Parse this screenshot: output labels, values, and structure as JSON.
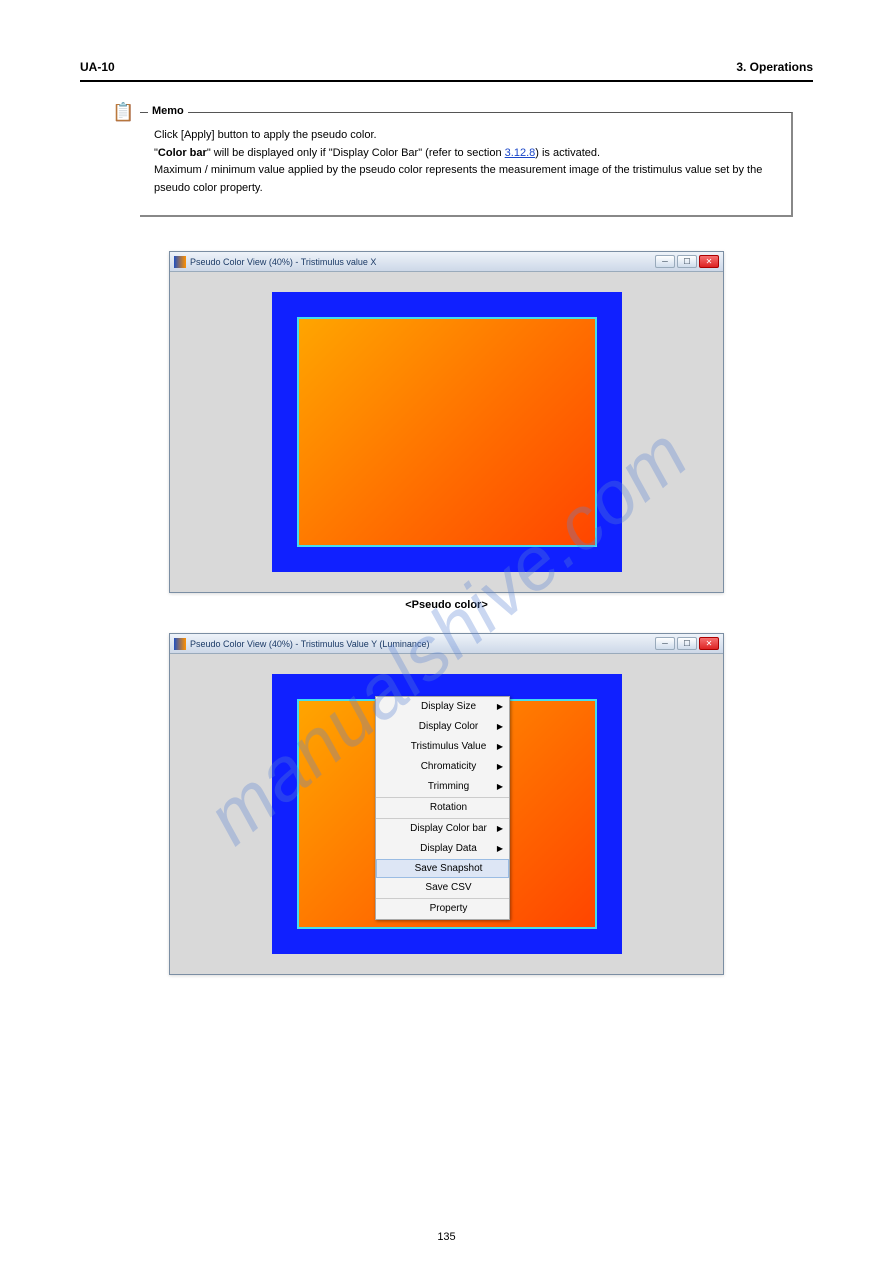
{
  "header": {
    "left": "UA-10",
    "right": "3. Operations"
  },
  "memo": {
    "label": "Memo",
    "line1": "Click [Apply] button to apply the pseudo color.",
    "line2_prefix": "\"",
    "line2_bold": "Color bar",
    "line2_mid": "\" will be displayed only if \"Display Color Bar\" (refer to section",
    "line2_ref": "3.12.8",
    "line2_end": ") is activated.",
    "line3": "Maximum / minimum value applied by the pseudo color represents the measurement image of the tristimulus value set by the pseudo color property."
  },
  "window1": {
    "title": "Pseudo Color View (40%) - Tristimulus value X",
    "caption": "<Pseudo color>"
  },
  "window2": {
    "title": "Pseudo Color View (40%) - Tristimulus Value Y (Luminance)",
    "menu": {
      "items": [
        {
          "label": "Display Size",
          "arrow": true
        },
        {
          "label": "Display Color",
          "arrow": true
        },
        {
          "label": "Tristimulus Value",
          "arrow": true
        },
        {
          "label": "Chromaticity",
          "arrow": true
        },
        {
          "label": "Trimming",
          "arrow": true
        },
        {
          "label": "Rotation",
          "arrow": false,
          "sep": true
        },
        {
          "label": "Display Color bar",
          "arrow": true,
          "sep": true
        },
        {
          "label": "Display Data",
          "arrow": true
        },
        {
          "label": "Save Snapshot",
          "arrow": false,
          "hover": true,
          "sep": true
        },
        {
          "label": "Save CSV",
          "arrow": false
        },
        {
          "label": "Property",
          "arrow": false,
          "sep": true
        }
      ]
    }
  },
  "footer": "135",
  "watermark": "manualshive.com"
}
